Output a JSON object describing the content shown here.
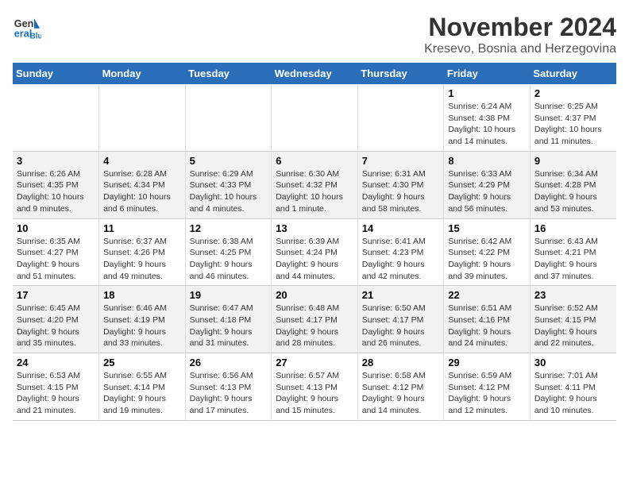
{
  "logo": {
    "line1": "General",
    "line2": "Blue"
  },
  "header": {
    "month": "November 2024",
    "location": "Kresevo, Bosnia and Herzegovina"
  },
  "weekdays": [
    "Sunday",
    "Monday",
    "Tuesday",
    "Wednesday",
    "Thursday",
    "Friday",
    "Saturday"
  ],
  "weeks": [
    [
      {
        "day": "",
        "info": ""
      },
      {
        "day": "",
        "info": ""
      },
      {
        "day": "",
        "info": ""
      },
      {
        "day": "",
        "info": ""
      },
      {
        "day": "",
        "info": ""
      },
      {
        "day": "1",
        "info": "Sunrise: 6:24 AM\nSunset: 4:38 PM\nDaylight: 10 hours\nand 14 minutes."
      },
      {
        "day": "2",
        "info": "Sunrise: 6:25 AM\nSunset: 4:37 PM\nDaylight: 10 hours\nand 11 minutes."
      }
    ],
    [
      {
        "day": "3",
        "info": "Sunrise: 6:26 AM\nSunset: 4:35 PM\nDaylight: 10 hours\nand 9 minutes."
      },
      {
        "day": "4",
        "info": "Sunrise: 6:28 AM\nSunset: 4:34 PM\nDaylight: 10 hours\nand 6 minutes."
      },
      {
        "day": "5",
        "info": "Sunrise: 6:29 AM\nSunset: 4:33 PM\nDaylight: 10 hours\nand 4 minutes."
      },
      {
        "day": "6",
        "info": "Sunrise: 6:30 AM\nSunset: 4:32 PM\nDaylight: 10 hours\nand 1 minute."
      },
      {
        "day": "7",
        "info": "Sunrise: 6:31 AM\nSunset: 4:30 PM\nDaylight: 9 hours\nand 58 minutes."
      },
      {
        "day": "8",
        "info": "Sunrise: 6:33 AM\nSunset: 4:29 PM\nDaylight: 9 hours\nand 56 minutes."
      },
      {
        "day": "9",
        "info": "Sunrise: 6:34 AM\nSunset: 4:28 PM\nDaylight: 9 hours\nand 53 minutes."
      }
    ],
    [
      {
        "day": "10",
        "info": "Sunrise: 6:35 AM\nSunset: 4:27 PM\nDaylight: 9 hours\nand 51 minutes."
      },
      {
        "day": "11",
        "info": "Sunrise: 6:37 AM\nSunset: 4:26 PM\nDaylight: 9 hours\nand 49 minutes."
      },
      {
        "day": "12",
        "info": "Sunrise: 6:38 AM\nSunset: 4:25 PM\nDaylight: 9 hours\nand 46 minutes."
      },
      {
        "day": "13",
        "info": "Sunrise: 6:39 AM\nSunset: 4:24 PM\nDaylight: 9 hours\nand 44 minutes."
      },
      {
        "day": "14",
        "info": "Sunrise: 6:41 AM\nSunset: 4:23 PM\nDaylight: 9 hours\nand 42 minutes."
      },
      {
        "day": "15",
        "info": "Sunrise: 6:42 AM\nSunset: 4:22 PM\nDaylight: 9 hours\nand 39 minutes."
      },
      {
        "day": "16",
        "info": "Sunrise: 6:43 AM\nSunset: 4:21 PM\nDaylight: 9 hours\nand 37 minutes."
      }
    ],
    [
      {
        "day": "17",
        "info": "Sunrise: 6:45 AM\nSunset: 4:20 PM\nDaylight: 9 hours\nand 35 minutes."
      },
      {
        "day": "18",
        "info": "Sunrise: 6:46 AM\nSunset: 4:19 PM\nDaylight: 9 hours\nand 33 minutes."
      },
      {
        "day": "19",
        "info": "Sunrise: 6:47 AM\nSunset: 4:18 PM\nDaylight: 9 hours\nand 31 minutes."
      },
      {
        "day": "20",
        "info": "Sunrise: 6:48 AM\nSunset: 4:17 PM\nDaylight: 9 hours\nand 28 minutes."
      },
      {
        "day": "21",
        "info": "Sunrise: 6:50 AM\nSunset: 4:17 PM\nDaylight: 9 hours\nand 26 minutes."
      },
      {
        "day": "22",
        "info": "Sunrise: 6:51 AM\nSunset: 4:16 PM\nDaylight: 9 hours\nand 24 minutes."
      },
      {
        "day": "23",
        "info": "Sunrise: 6:52 AM\nSunset: 4:15 PM\nDaylight: 9 hours\nand 22 minutes."
      }
    ],
    [
      {
        "day": "24",
        "info": "Sunrise: 6:53 AM\nSunset: 4:15 PM\nDaylight: 9 hours\nand 21 minutes."
      },
      {
        "day": "25",
        "info": "Sunrise: 6:55 AM\nSunset: 4:14 PM\nDaylight: 9 hours\nand 19 minutes."
      },
      {
        "day": "26",
        "info": "Sunrise: 6:56 AM\nSunset: 4:13 PM\nDaylight: 9 hours\nand 17 minutes."
      },
      {
        "day": "27",
        "info": "Sunrise: 6:57 AM\nSunset: 4:13 PM\nDaylight: 9 hours\nand 15 minutes."
      },
      {
        "day": "28",
        "info": "Sunrise: 6:58 AM\nSunset: 4:12 PM\nDaylight: 9 hours\nand 14 minutes."
      },
      {
        "day": "29",
        "info": "Sunrise: 6:59 AM\nSunset: 4:12 PM\nDaylight: 9 hours\nand 12 minutes."
      },
      {
        "day": "30",
        "info": "Sunrise: 7:01 AM\nSunset: 4:11 PM\nDaylight: 9 hours\nand 10 minutes."
      }
    ]
  ]
}
